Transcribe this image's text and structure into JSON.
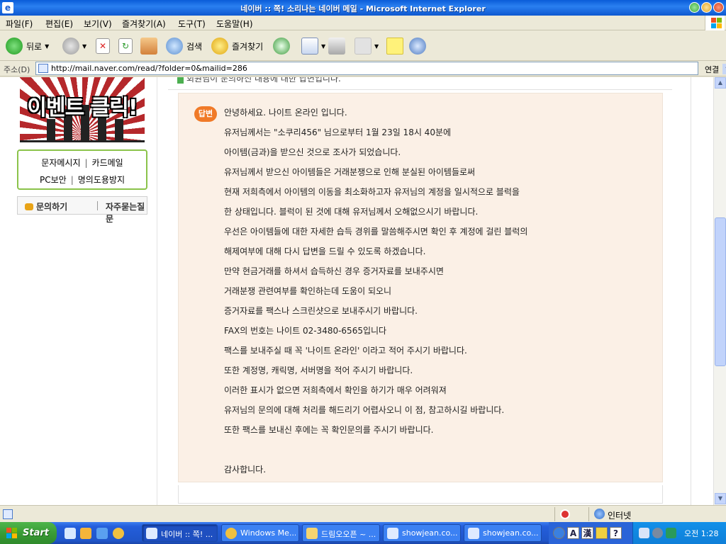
{
  "window": {
    "title": "네이버 :: 쪽! 소리나는 네이버 메일 - Microsoft Internet Explorer"
  },
  "menu": [
    "파일(F)",
    "편집(E)",
    "보기(V)",
    "즐겨찾기(A)",
    "도구(T)",
    "도움말(H)"
  ],
  "toolbar": {
    "back": "뒤로",
    "search": "검색",
    "favorites": "즐겨찾기"
  },
  "address": {
    "label": "주소(D)",
    "url": "http://mail.naver.com/read/?folder=0&mailid=286",
    "go": "연결"
  },
  "left": {
    "banner_text": "이벤트 클릭!",
    "sms": "문자메시지",
    "card_mail": "카드메일",
    "pc_security": "PC보안",
    "anti_identity": "명의도용방지",
    "inquiry": "문의하기",
    "faq": "자주묻는질문"
  },
  "mail": {
    "header_text": "회원님이 문의하신 내용에 대한 답변입니다.",
    "badge": "답변",
    "lines": [
      "안녕하세요. 나이트 온라인 입니다.",
      "유저님께서는 \"소쿠리456\" 님으로부터 1월 23일 18시 40분에",
      "아이템(금과)을 받으신 것으로 조사가 되었습니다.",
      "유저님께서 받으신 아이템들은 거래분쟁으로 인해 분실된 아이템들로써",
      "현재 저희측에서 아이템의 이동을 최소화하고자 유저님의 계정을 일시적으로 블럭을",
      "한 상태입니다. 블럭이 된 것에 대해 유저님께서 오해없으시기 바랍니다.",
      "우선은 아이템들에 대한 자세한 습득 경위를 말씀해주시면 확인 후 계정에 걸린 블럭의",
      "해제여부에 대해 다시 답변을 드릴 수 있도록 하겠습니다.",
      "만약 현금거래를 하셔서 습득하신 경우 증거자료를 보내주시면",
      "거래분쟁 관련여부를 확인하는데 도움이 되오니",
      "증거자료를 팩스나 스크린샷으로 보내주시기 바랍니다.",
      "FAX의 번호는 나이트 02-3480-6565입니다",
      "팩스를 보내주실 때 꼭 '나이트 온라인' 이라고 적어 주시기 바랍니다.",
      "또한 계정명, 캐릭명, 서버명을 적어 주시기 바랍니다.",
      "이러한 표시가 없으면 저희측에서 확인을 하기가 매우 어려워져",
      "유저님의 문의에 대해 처리를 해드리기 어렵사오니 이 점, 참고하시길 바랍니다.",
      "또한 팩스를 보내신 후에는 꼭 확인문의를 주시기 바랍니다.",
      "",
      "감사합니다."
    ]
  },
  "status": {
    "zone": "인터넷"
  },
  "taskbar": {
    "start": "Start",
    "tasks": [
      {
        "label": "네이버 :: 쪽! ...",
        "active": true
      },
      {
        "label": "Windows Me...",
        "active": false
      },
      {
        "label": "드림오오픈 ~ ...",
        "active": false
      },
      {
        "label": "showjean.co...",
        "active": false
      },
      {
        "label": "showjean.co...",
        "active": false
      }
    ],
    "clock": "오전 1:28"
  },
  "colors": {
    "accent_orange": "#f07a28",
    "answer_bg": "#fbf0e6",
    "green_border": "#8bc34a"
  }
}
